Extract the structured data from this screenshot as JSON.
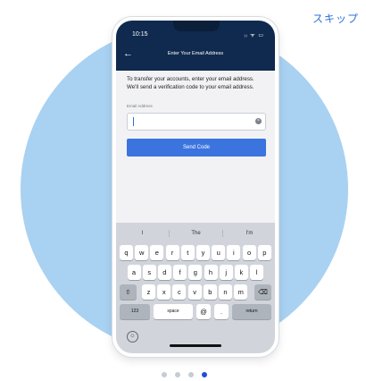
{
  "skip_label": "スキップ",
  "status_bar": {
    "time": "10:15",
    "icons": "ᵢᵢ ᯤ ▭"
  },
  "header": {
    "title": "Enter Your Email Address",
    "back_icon": "←"
  },
  "content": {
    "instruction": "To transfer your accounts, enter your email address. We'll send a verification code to your email address.",
    "email_label": "Email Address",
    "email_value": "",
    "send_button": "Send Code"
  },
  "keyboard": {
    "suggestions": [
      "I",
      "The",
      "I'm"
    ],
    "row1": [
      "q",
      "w",
      "e",
      "r",
      "t",
      "y",
      "u",
      "i",
      "o",
      "p"
    ],
    "row2": [
      "a",
      "s",
      "d",
      "f",
      "g",
      "h",
      "j",
      "k",
      "l"
    ],
    "row3": [
      "z",
      "x",
      "c",
      "v",
      "b",
      "n",
      "m"
    ],
    "shift_icon": "⇧",
    "backspace_icon": "⌫",
    "numbers_key": "123",
    "space_key": "space",
    "at_key": "@",
    "dot_key": ".",
    "return_key": "return",
    "emoji_icon": "☺"
  },
  "pagination": {
    "total": 4,
    "active": 4
  },
  "colors": {
    "accent": "#2f6fde",
    "header": "#0f2a4e",
    "circle": "#a9d1f1",
    "active_dot": "#1f4ed8"
  }
}
